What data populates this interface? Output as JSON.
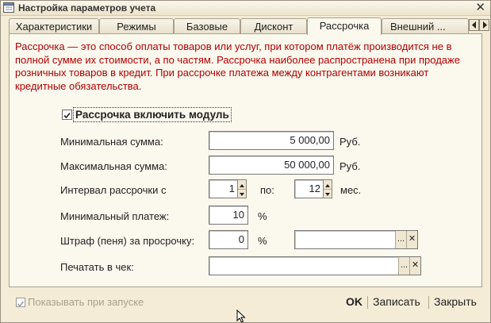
{
  "window": {
    "title": "Настройка параметров учета",
    "close_glyph": "✕"
  },
  "tabs": [
    {
      "label": "Характеристики"
    },
    {
      "label": "Режимы"
    },
    {
      "label": "Базовые"
    },
    {
      "label": "Дисконт"
    },
    {
      "label": "Рассрочка",
      "active": true
    },
    {
      "label": "Внешний ..."
    }
  ],
  "description": "Рассрочка — это способ оплаты товаров или услуг, при котором платёж производится не в полной сумме их стоимости, а по частям. Рассрочка наиболее распространена при продаже розничных товаров в кредит. При рассрочке платежа между контрагентами возникают кредитные обязательства.",
  "module": {
    "label": "Рассрочка включить модуль",
    "checked": true
  },
  "form": {
    "min_sum": {
      "label": "Минимальная сумма:",
      "value": "5 000,00",
      "unit": "Руб."
    },
    "max_sum": {
      "label": "Максимальная сумма:",
      "value": "50 000,00",
      "unit": "Руб."
    },
    "interval": {
      "label": "Интервал рассрочки с",
      "from": "1",
      "to_label": "по:",
      "to": "12",
      "unit": "мес."
    },
    "min_payment": {
      "label": "Минимальный платеж:",
      "value": "10",
      "unit": "%"
    },
    "penalty": {
      "label": "Штраф (пеня) за просрочку:",
      "value": "0",
      "unit": "%",
      "account": ""
    },
    "print": {
      "label": "Печатать в чек:",
      "value": ""
    }
  },
  "buttons": {
    "select": "...",
    "clear": "✕"
  },
  "footer": {
    "show_on_start": {
      "label": "Показывать при запуске",
      "checked": true
    },
    "ok": "OK",
    "save": "Записать",
    "close": "Закрыть"
  },
  "colors": {
    "description_text": "#b00000",
    "window_bg": "#f4ecd6",
    "panel_bg": "#fbf8ee"
  }
}
